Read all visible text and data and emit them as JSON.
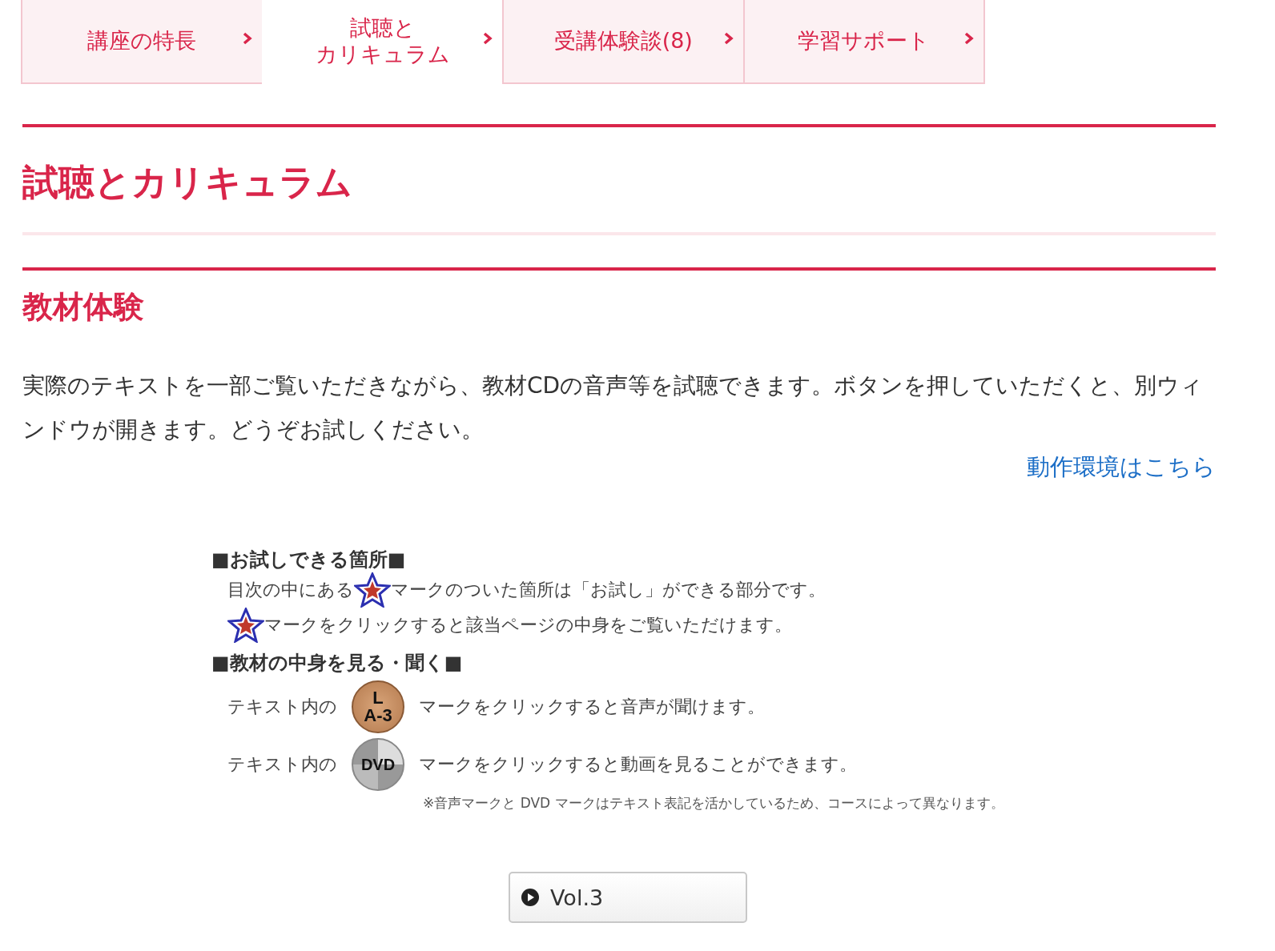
{
  "tabs": [
    {
      "lines": [
        "講座の特長"
      ],
      "selected": false
    },
    {
      "lines": [
        "試聴と",
        "カリキュラム"
      ],
      "selected": true
    },
    {
      "lines": [
        "受講体験談(8)"
      ],
      "selected": false
    },
    {
      "lines": [
        "学習サポート"
      ],
      "selected": false
    }
  ],
  "page_title": "試聴とカリキュラム",
  "section": {
    "heading": "教材体験",
    "description": "実際のテキストを一部ご覧いただきながら、教材CDの音声等を試聴できます。ボタンを押していただくと、別ウィンドウが開きます。どうぞお試しください。",
    "link": "動作環境はこちら",
    "guide": {
      "heading_1": "■お試しできる箇所■",
      "line_1a": "目次の中にある",
      "line_1b": "マークのついた箇所は「お試し」ができる部分です。",
      "line_2": "マークをクリックすると該当ページの中身をご覧いただけます。",
      "heading_2": "■教材の中身を見る・聞く■",
      "rows": [
        {
          "kind": "audio",
          "prefix": "テキスト内の",
          "badge_top": "L",
          "badge_bottom": "A-3",
          "text": "マークをクリックすると音声が聞けます。"
        },
        {
          "kind": "dvd",
          "prefix": "テキスト内の",
          "badge_top": "DVD",
          "text": "マークをクリックすると動画を見ることができます。"
        }
      ],
      "note": "※音声マークと DVD マークはテキスト表記を活かしているため、コースによって異なります。"
    },
    "button": "Vol.3"
  }
}
